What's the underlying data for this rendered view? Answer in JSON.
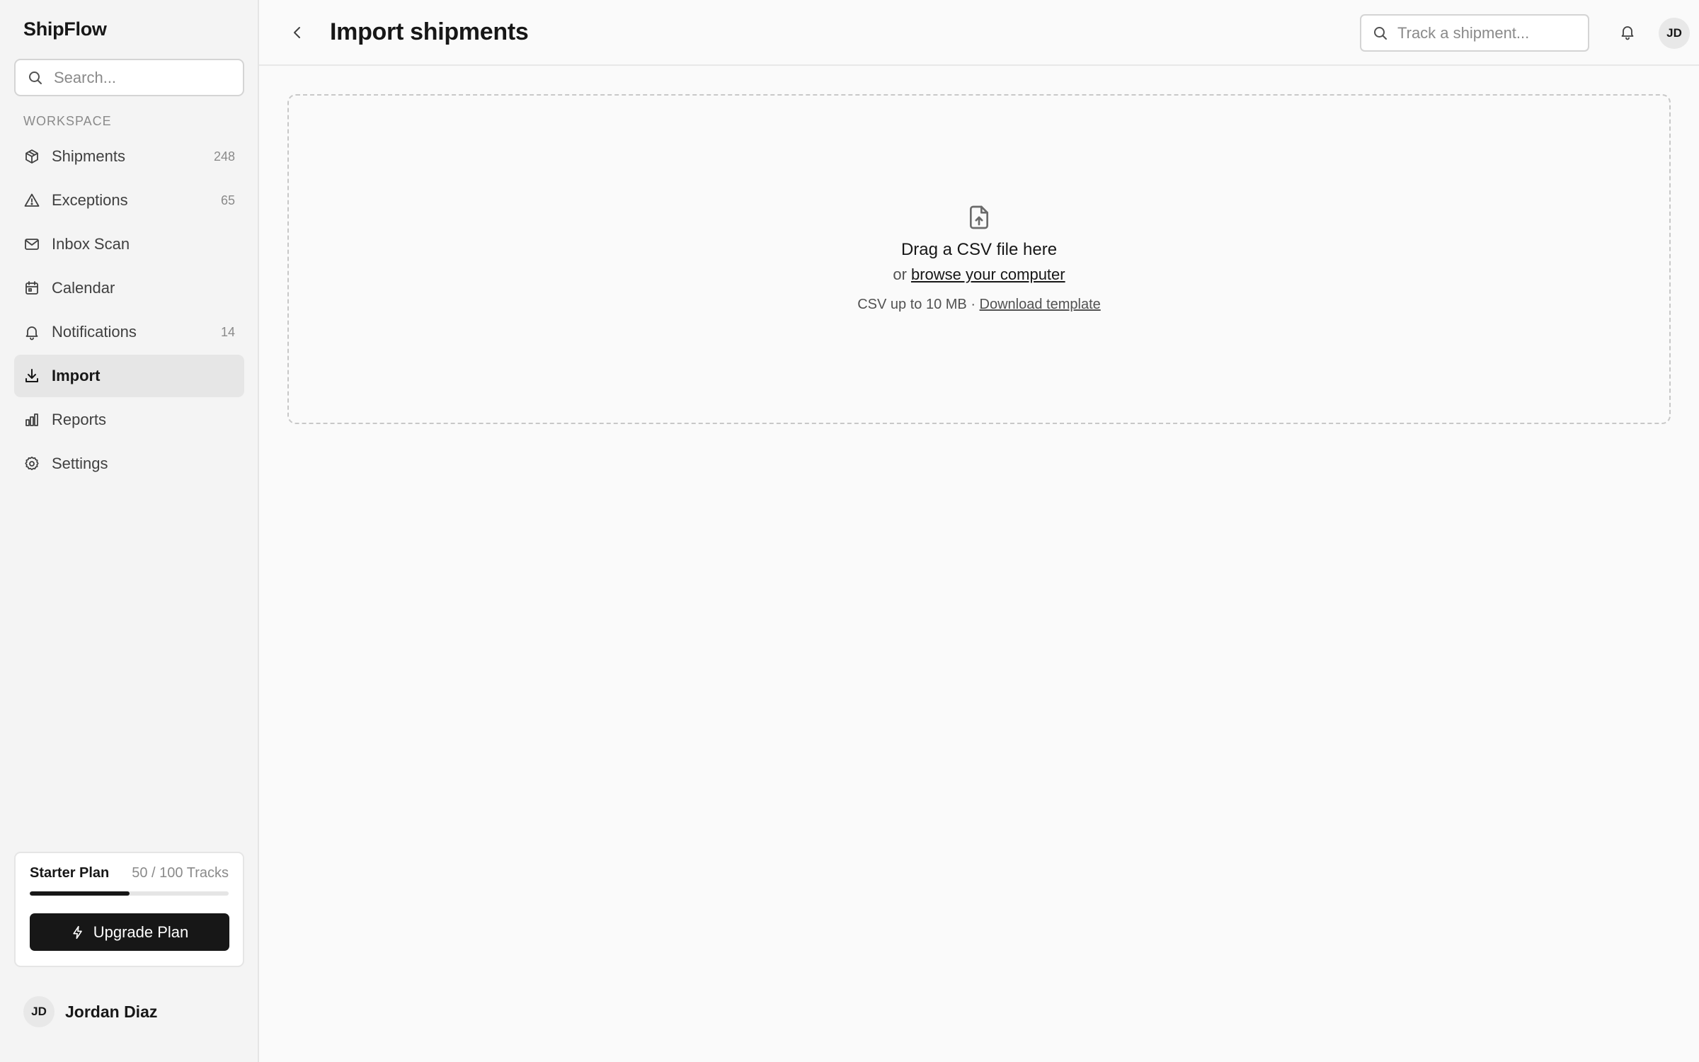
{
  "sidebar": {
    "brand": "ShipFlow",
    "search_placeholder": "Search...",
    "section_label": "WORKSPACE",
    "items": [
      {
        "label": "Shipments",
        "count": "248",
        "icon": "package-icon"
      },
      {
        "label": "Exceptions",
        "count": "65",
        "icon": "alert-triangle-icon"
      },
      {
        "label": "Inbox Scan",
        "count": "",
        "icon": "mail-icon"
      },
      {
        "label": "Calendar",
        "count": "",
        "icon": "calendar-icon"
      },
      {
        "label": "Notifications",
        "count": "14",
        "icon": "bell-icon"
      },
      {
        "label": "Import",
        "count": "",
        "icon": "download-icon",
        "active": true
      },
      {
        "label": "Reports",
        "count": "",
        "icon": "bar-chart-icon"
      },
      {
        "label": "Settings",
        "count": "",
        "icon": "gear-icon"
      }
    ],
    "plan": {
      "name": "Starter Plan",
      "usage": "50 / 100 Tracks",
      "progress": 0.5,
      "upgrade_label": "Upgrade Plan"
    },
    "user": {
      "initials": "JD",
      "name": "Jordan Diaz"
    }
  },
  "header": {
    "title": "Import shipments",
    "track_placeholder": "Track a shipment...",
    "avatar_initials": "JD"
  },
  "dropzone": {
    "title": "Drag a CSV file here",
    "or_text": "or",
    "browse_link": "browse your computer",
    "hint": "CSV up to 10 MB ·",
    "template_link": "Download template"
  },
  "colors": {
    "accent": "#171717",
    "sidebar_bg": "#f4f4f4",
    "active_bg": "#e6e6e6",
    "muted": "#8a8a8a"
  }
}
